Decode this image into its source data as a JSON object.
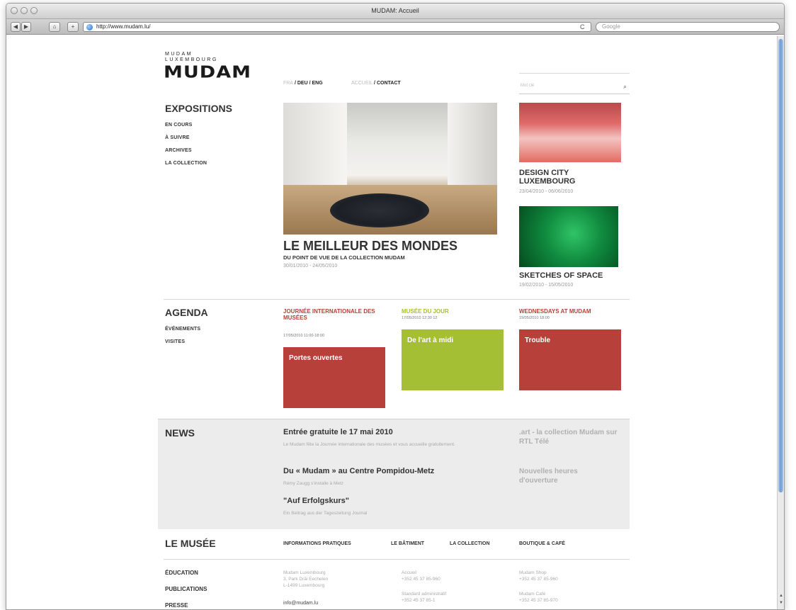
{
  "browser": {
    "window_title": "MUDAM: Accueil",
    "url": "http://www.mudam.lu/",
    "search_placeholder": "Google",
    "nav_back": "◀",
    "nav_forward": "▶",
    "home": "⌂",
    "add": "+",
    "reload": "C"
  },
  "logo": {
    "line1": "MUDAM",
    "line2": "LUXEMBOURG",
    "mark": "MUDAM"
  },
  "languages": {
    "fra": "FRA",
    "deu": "DEU",
    "eng": "ENG",
    "sep": "/"
  },
  "topnav": {
    "accueil": "ACCUEIL",
    "contact": "CONTACT",
    "sep": "/"
  },
  "site_search": {
    "placeholder": "Mot clé"
  },
  "expositions": {
    "title": "EXPOSITIONS",
    "links": [
      "EN COURS",
      "À SUIVRE",
      "ARCHIVES",
      "LA COLLECTION"
    ]
  },
  "featured": {
    "title": "LE MEILLEUR DES MONDES",
    "subtitle": "DU POINT DE VUE DE LA COLLECTION MUDAM",
    "dates": "30/01/2010 - 24/05/2010"
  },
  "side_exhibitions": [
    {
      "title": "DESIGN CITY LUXEMBOURG",
      "dates": "23/04/2010 - 06/06/2010"
    },
    {
      "title": "SKETCHES OF SPACE",
      "dates": "19/02/2010 - 15/05/2010"
    }
  ],
  "agenda": {
    "title": "AGENDA",
    "links": [
      "ÉVÉNEMENTS",
      "VISITES"
    ],
    "items": [
      {
        "heading": "JOURNÉE INTERNATIONALE DES MUSÉES",
        "date": "17/05/2010 11:00-18:00",
        "label": "Portes ouvertes",
        "color": "#b8403a"
      },
      {
        "heading": "MUSÉE DU JOUR",
        "date": "17/05/2010 12:30 12",
        "label": "De l'art à midi",
        "color": "#a5bf34"
      },
      {
        "heading": "WEDNESDAYS AT MUDAM",
        "date": "19/05/2010 18:00",
        "label": "Trouble",
        "color": "#b8403a"
      }
    ]
  },
  "news": {
    "title": "NEWS",
    "items": [
      {
        "title": "Entrée gratuite le 17 mai 2010",
        "text": "Le Mudam fête la Journée internationale des musées et vous accueille gratuitement."
      },
      {
        "title": "Du « Mudam » au Centre Pompidou-Metz",
        "text": "Rémy Zaugg s'installe à Metz"
      },
      {
        "title": "\"Auf Erfolgskurs\"",
        "text": "Ein Beitrag aus der Tageszeitung Journal"
      }
    ],
    "side": [
      ".art - la collection Mudam sur RTL Télé",
      "Nouvelles heures d'ouverture"
    ]
  },
  "musee": {
    "title": "LE MUSÉE",
    "links": [
      "INFORMATIONS PRATIQUES",
      "LE BÂTIMENT",
      "LA COLLECTION",
      "BOUTIQUE & CAFÉ"
    ]
  },
  "footer": {
    "links": [
      "ÉDUCATION",
      "PUBLICATIONS",
      "PRESSE"
    ],
    "address": [
      "Mudam Luxembourg",
      "3, Park Dräi Eechelen",
      "L-1499 Luxembourg"
    ],
    "email": "info@mudam.lu",
    "accueil": [
      "Accueil",
      "+352 45 37 85-960"
    ],
    "standard": [
      "Standard administratif",
      "+352 45 37 85-1"
    ],
    "shop": [
      "Mudam Shop",
      "+352 45 37 85-960"
    ],
    "cafe": [
      "Mudam Café",
      "+352 45 37 85-970"
    ]
  },
  "colors": {
    "red": "#b8403a",
    "green": "#a5bf34",
    "news_bg": "#ececec"
  }
}
